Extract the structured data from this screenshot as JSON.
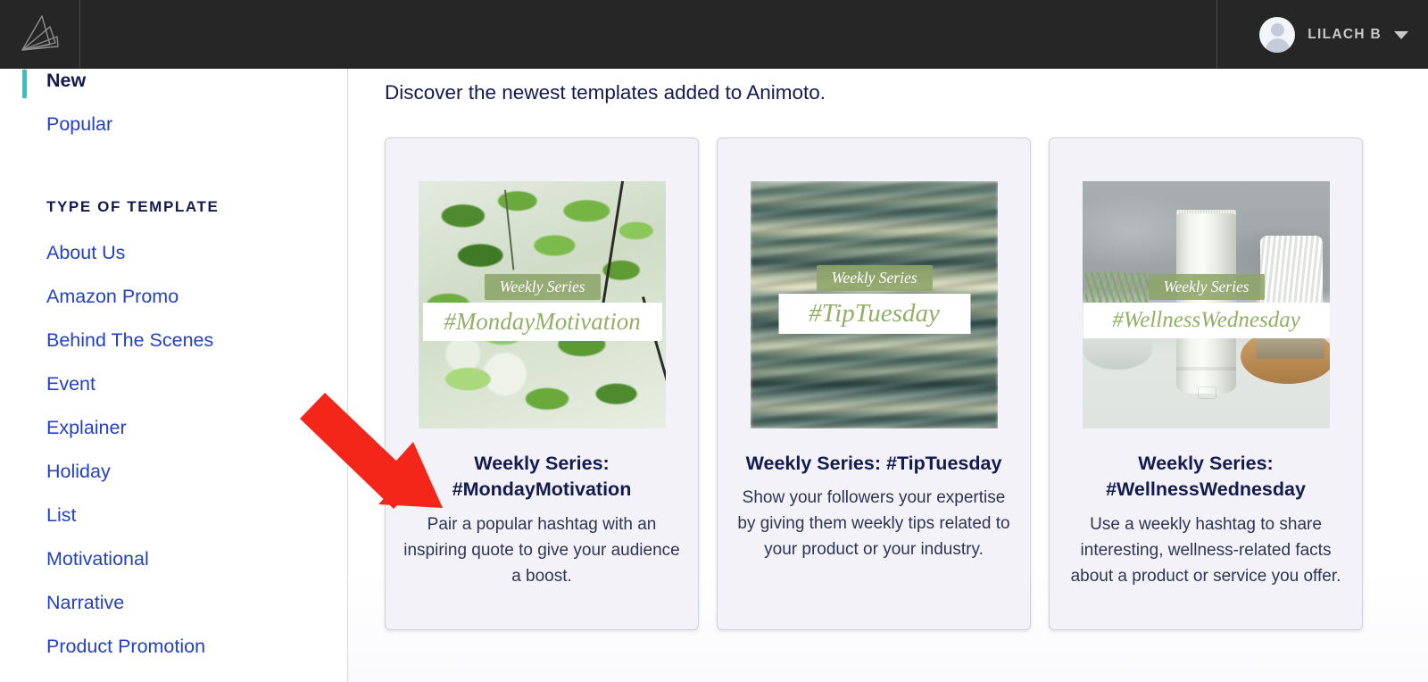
{
  "header": {
    "logo_name": "animoto-logo",
    "account_name": "LILACH B",
    "chevron": "chevron-down-icon"
  },
  "sidebar": {
    "primary": [
      {
        "label": "New",
        "active": true
      },
      {
        "label": "Popular",
        "active": false
      }
    ],
    "section_title": "TYPE OF TEMPLATE",
    "items": [
      {
        "label": "About Us"
      },
      {
        "label": "Amazon Promo"
      },
      {
        "label": "Behind The Scenes"
      },
      {
        "label": "Event"
      },
      {
        "label": "Explainer"
      },
      {
        "label": "Holiday"
      },
      {
        "label": "List"
      },
      {
        "label": "Motivational"
      },
      {
        "label": "Narrative"
      },
      {
        "label": "Product Promotion"
      }
    ]
  },
  "main": {
    "lead": "Discover the newest templates added to Animoto.",
    "cards": [
      {
        "thumb_series": "Weekly Series",
        "thumb_hashtag": "#MondayMotivation",
        "title": "Weekly Series: #MondayMotivation",
        "description": "Pair a popular hashtag with an inspiring quote to give your audience a boost."
      },
      {
        "thumb_series": "Weekly Series",
        "thumb_hashtag": "#TipTuesday",
        "title": "Weekly Series: #TipTuesday",
        "description": "Show your followers your expertise by giving them weekly tips related to your product or your industry."
      },
      {
        "thumb_series": "Weekly Series",
        "thumb_hashtag": "#WellnessWednesday",
        "title": "Weekly Series: #WellnessWednesday",
        "description": "Use a weekly hashtag to share interesting, wellness-related facts about a product or service you offer."
      }
    ]
  },
  "annotation": {
    "arrow_color": "#F32619"
  },
  "colors": {
    "topbar_bg": "#262626",
    "accent_teal": "#2AC5C5",
    "link_blue": "#2440C6",
    "navy_text": "#131A4D",
    "card_bg": "#F2F2F8",
    "card_border": "#CCD0E0",
    "band_green": "#8DA469",
    "hashtag_green": "#92AE67"
  }
}
